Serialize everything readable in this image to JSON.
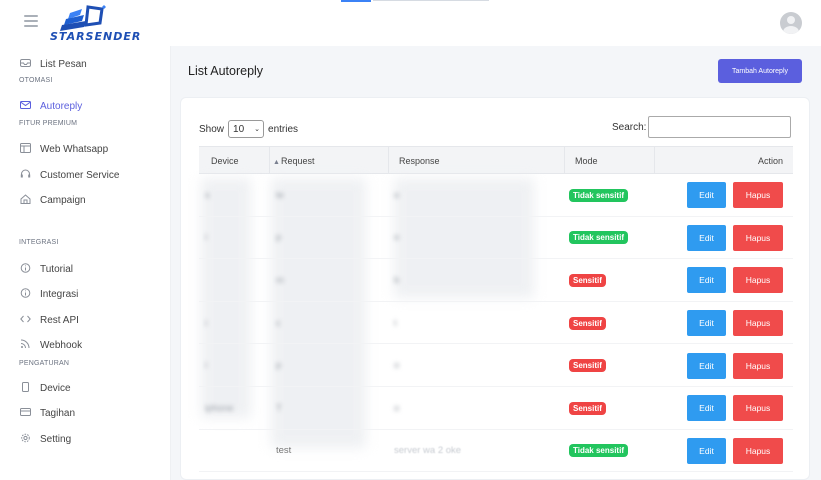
{
  "header": {
    "logo_text": "STARSENDER",
    "accent_color": "#5b5fde"
  },
  "sidebar": {
    "items": [
      {
        "label": "List Pesan",
        "icon": "inbox-icon"
      },
      {
        "section": "OTOMASI"
      },
      {
        "label": "Autoreply",
        "icon": "envelope-icon",
        "active": true
      },
      {
        "section": "FITUR PREMIUM"
      },
      {
        "label": "Web Whatsapp",
        "icon": "browser-icon"
      },
      {
        "label": "Customer Service",
        "icon": "headset-icon"
      },
      {
        "label": "Campaign",
        "icon": "home-icon"
      },
      {
        "section": "INTEGRASI"
      },
      {
        "label": "Tutorial",
        "icon": "info-circle-icon"
      },
      {
        "label": "Integrasi",
        "icon": "info-circle-icon"
      },
      {
        "label": "Rest API",
        "icon": "code-icon"
      },
      {
        "label": "Webhook",
        "icon": "rss-icon"
      },
      {
        "section": "PENGATURAN"
      },
      {
        "label": "Device",
        "icon": "phone-icon"
      },
      {
        "label": "Tagihan",
        "icon": "credit-card-icon"
      },
      {
        "label": "Setting",
        "icon": "gear-icon"
      }
    ]
  },
  "main": {
    "title": "List Autoreply",
    "add_button": "Tambah Autoreply",
    "show_label": "Show",
    "entries_value": "10",
    "entries_label": "entries",
    "search_label": "Search:",
    "search_value": "",
    "columns": [
      "Device",
      "Request",
      "Response",
      "Mode",
      "Action"
    ],
    "rows": [
      {
        "device": "s",
        "request": "te",
        "response": "o",
        "mode": "Tidak sensitif",
        "mode_color": "green"
      },
      {
        "device": "i",
        "request": "p",
        "response": "o",
        "mode": "Tidak sensitif",
        "mode_color": "green"
      },
      {
        "device": "",
        "request": "m",
        "response": "b",
        "mode": "Sensitif",
        "mode_color": "red"
      },
      {
        "device": "i",
        "request": "c",
        "response": "t",
        "mode": "Sensitif",
        "mode_color": "red"
      },
      {
        "device": "i",
        "request": "p",
        "response": "o",
        "mode": "Sensitif",
        "mode_color": "red"
      },
      {
        "device": "iphone",
        "request": "T",
        "response": "o",
        "mode": "Sensitif",
        "mode_color": "red"
      },
      {
        "device": "",
        "request": "test",
        "response": "server wa 2 oke",
        "mode": "Tidak sensitif",
        "mode_color": "green"
      }
    ],
    "edit_label": "Edit",
    "delete_label": "Hapus"
  }
}
